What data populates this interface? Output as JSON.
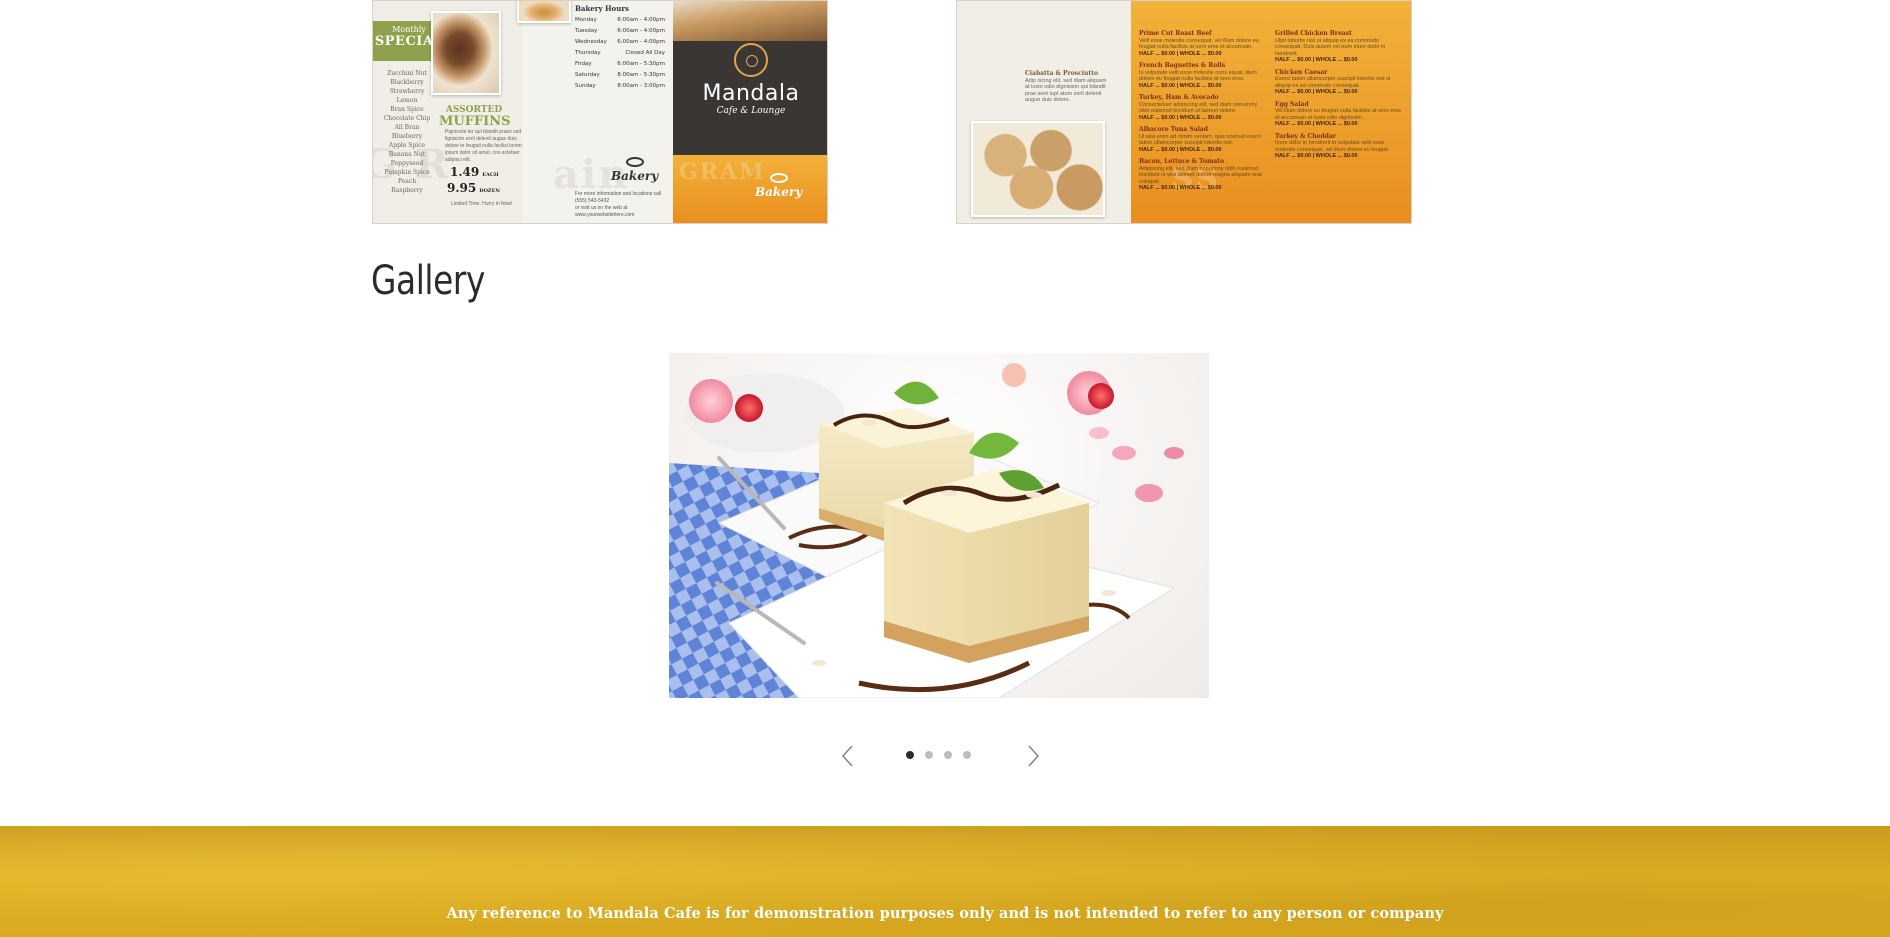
{
  "menu_left": {
    "special_small": "Monthly",
    "special_big": "SPECIAL",
    "flavors": [
      "Zucchini Nut",
      "Blackberry",
      "Strawberry",
      "Lemon",
      "Bran Spice",
      "Chocolate Chip",
      "All Bran",
      "Blueberry",
      "Apple Spice",
      "Banana Nut",
      "Poppyseed",
      "Pumpkin Spice",
      "Peach",
      "Raspberry"
    ],
    "muffins_title_1": "ASSORTED",
    "muffins_title_2": "MUFFINS",
    "muffins_desc": "Pigniscite ter qui blandit praes sed ligniscim zeril delenit augue duis dolore te feugait nulla facilisi lorem ipsum dolor sit amet, cos ectetuer adipisci elit.",
    "price_each": "1.49",
    "price_each_unit": "EACH",
    "price_dozen": "9.95",
    "price_dozen_unit": "DOZEN",
    "limited": "Limited Time. Hurry in Now!",
    "hours_title": "Bakery Hours",
    "hours": [
      {
        "day": "Monday",
        "time": "6:00am - 4:00pm"
      },
      {
        "day": "Tuesday",
        "time": "6:00am - 4:00pm"
      },
      {
        "day": "Wednesday",
        "time": "6:00am - 4:00pm"
      },
      {
        "day": "Thursday",
        "time": "Closed All Day"
      },
      {
        "day": "Friday",
        "time": "6:00am - 5:30pm"
      },
      {
        "day": "Saturday",
        "time": "8:00am - 5:30pm"
      },
      {
        "day": "Sunday",
        "time": "8:00am - 3:00pm"
      }
    ],
    "bakery_label": "Bakery",
    "contact_line1": "For more information and locations call (555) 543-5432",
    "contact_line2": "or visit us on the web at www.yourwebsitehere.com",
    "brand_name": "Mandala",
    "brand_sub": "Cafe & Lounge",
    "bakery_label_2": "Bakery"
  },
  "menu_right": {
    "left_items": [
      {
        "name": "Ciabatta & Prosciutto",
        "desc": "Adip iscing elit, sed diam aliquam at iusto odio dignissim qui blandit prae sent lupt atum zeril delenit augue duis dolore."
      }
    ],
    "col1": [
      {
        "name": "Prime Cut Roast Beef",
        "desc": "Velit esse molestie consequat, vel illum dolore eu feugiat nulla facilisis at vero eros et accumsan.",
        "price": "HALF ... $0.00 | WHOLE ... $0.00"
      },
      {
        "name": "French Baguettes & Rolls",
        "desc": "Iu vulputate velit esse molestie cons equat, illum dolore eu feugiat nulla facilisis at vero eros.",
        "price": "HALF ... $0.00 | WHOLE ... $0.00"
      },
      {
        "name": "Turkey, Ham & Avocado",
        "desc": "Consectetuer adipiscing elit, sed diam nonummy nibh euismod tincidunt ut laoreet dolore.",
        "price": "HALF ... $0.00 | WHOLE ... $0.00"
      },
      {
        "name": "Albacore Tuna Salad",
        "desc": "Ut wisi enim ad minim veniam, quis nostrud exerci tation ullamcorper suscipit lobortis nisl.",
        "price": "HALF ... $0.00 | WHOLE ... $0.00"
      },
      {
        "name": "Bacon, Lettuce & Tomato",
        "desc": "Adipiscing elit, sed diam nonummy nibh euismod tincidunt ut wisi laoreet dolore magna aliquam erat volutpat.",
        "price": "HALF ... $0.00 | WHOLE ... $0.00"
      }
    ],
    "col2": [
      {
        "name": "Grilled Chicken Breast",
        "desc": "Ulpit lobortis nisl ut aliquip ex ea commodo consequat. Duis autem vel eum iriure dolor in hendrerit.",
        "price": "HALF ... $0.00 | WHOLE ... $0.00"
      },
      {
        "name": "Chicken Caesar",
        "desc": "Exerci tation ullamcorper suscipit lobortis nisl ut aliquip ex ea commodo consequat.",
        "price": "HALF ... $0.00 | WHOLE ... $0.00"
      },
      {
        "name": "Egg Salad",
        "desc": "Vel illum dolore eu feugiat nulla facilisis at vero eros et accumsan et iusto odio dignissim.",
        "price": "HALF ... $0.00 | WHOLE ... $0.00"
      },
      {
        "name": "Turkey & Cheddar",
        "desc": "Iriure dolor in hendrerit in vulputate velit esse molestie consequat, vel illum dolore eu feugiat.",
        "price": "HALF ... $0.00 | WHOLE ... $0.00"
      }
    ]
  },
  "gallery": {
    "heading": "Gallery",
    "slide_count": 4,
    "active_slide": 1,
    "slide_description_icon": "cheesecake-photo"
  },
  "footer": {
    "text": "Any reference to Mandala Cafe is for demonstration purposes only and is not intended to refer to any person or company"
  },
  "colors": {
    "heading": "#2b2b2b",
    "dot_active": "#2d2d2d",
    "dot_inactive": "#bdbdbd",
    "footer_gold": "#d9aa21",
    "footer_text": "#ffffff",
    "menu_green": "#8ea24b",
    "menu_orange": "#e98e1f"
  }
}
